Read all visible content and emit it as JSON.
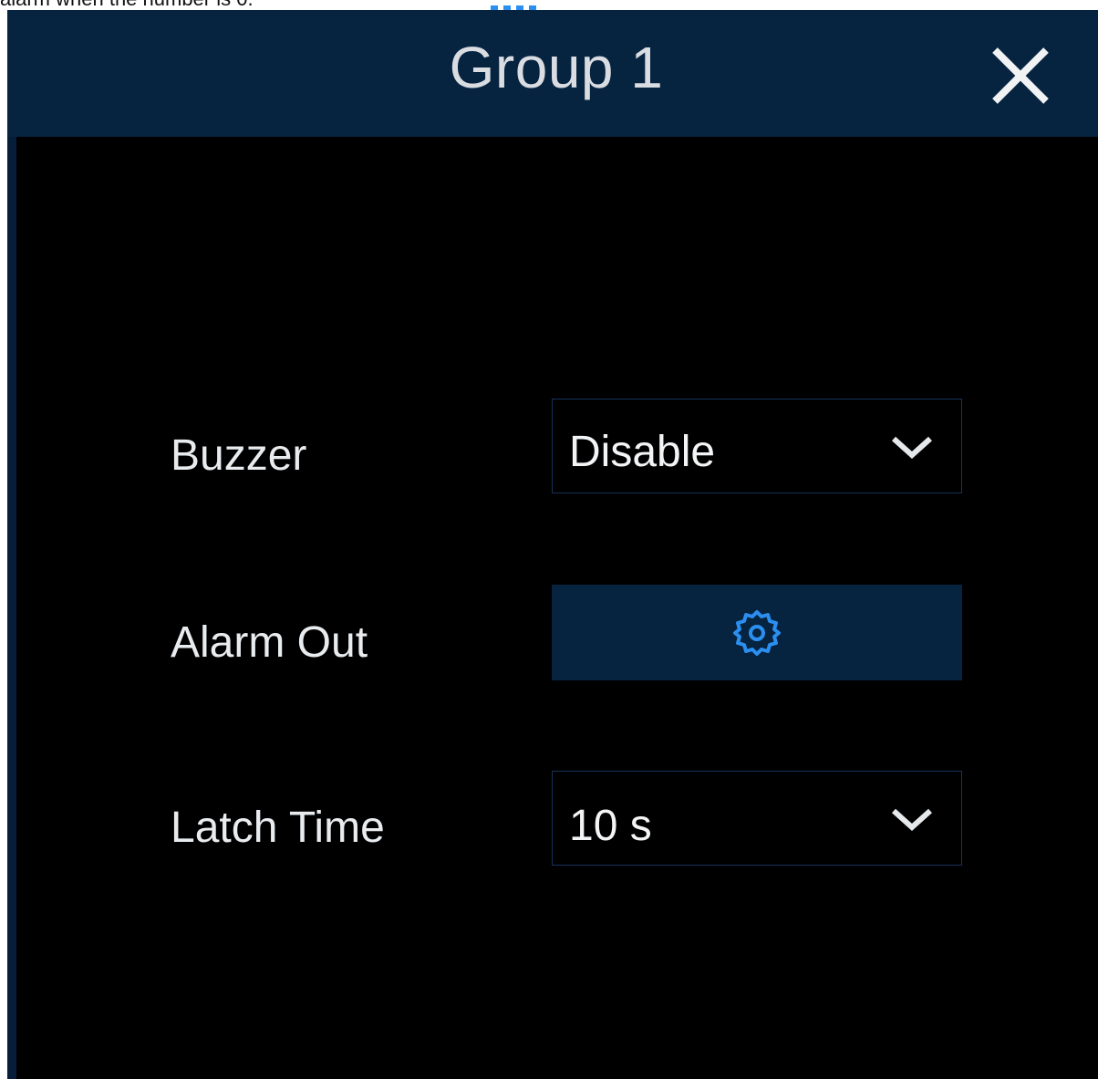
{
  "behind": {
    "fragment_text": "alarm when the number is 0."
  },
  "dialog": {
    "title": "Group 1",
    "close_icon": "close-icon",
    "rows": {
      "buzzer": {
        "label": "Buzzer",
        "value": "Disable"
      },
      "alarm_out": {
        "label": "Alarm Out",
        "icon": "gear-icon"
      },
      "latch_time": {
        "label": "Latch Time",
        "value": "10 s"
      }
    }
  },
  "colors": {
    "titlebar": "#062340",
    "body": "#000000",
    "accent_icon": "#2a8ff0",
    "text": "#e9ecef",
    "field_border": "#17335a"
  }
}
